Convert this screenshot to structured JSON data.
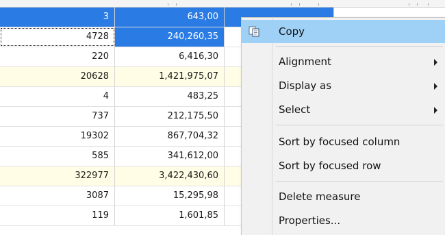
{
  "table": {
    "rows": [
      {
        "c1": "3",
        "c2": "643,00",
        "selected": true,
        "alt": false
      },
      {
        "c1": "4728",
        "c2": "240,260,35",
        "selected": false,
        "alt": false
      },
      {
        "c1": "220",
        "c2": "6,416,30",
        "selected": false,
        "alt": false
      },
      {
        "c1": "20628",
        "c2": "1,421,975,07",
        "selected": false,
        "alt": true
      },
      {
        "c1": "4",
        "c2": "483,25",
        "selected": false,
        "alt": false
      },
      {
        "c1": "737",
        "c2": "212,175,50",
        "selected": false,
        "alt": false
      },
      {
        "c1": "19302",
        "c2": "867,704,32",
        "selected": false,
        "alt": false
      },
      {
        "c1": "585",
        "c2": "341,612,00",
        "selected": false,
        "alt": false
      },
      {
        "c1": "322977",
        "c2": "3,422,430,60",
        "selected": false,
        "alt": true
      },
      {
        "c1": "3087",
        "c2": "15,295,98",
        "selected": false,
        "alt": false
      },
      {
        "c1": "119",
        "c2": "1,601,85",
        "selected": false,
        "alt": false
      }
    ]
  },
  "context_menu": {
    "items": [
      {
        "label": "Copy",
        "icon": "copy-icon",
        "highlighted": true
      },
      {
        "label": "Alignment",
        "submenu": true
      },
      {
        "label": "Display as",
        "submenu": true
      },
      {
        "label": "Select",
        "submenu": true
      },
      {
        "label": "Sort by focused column"
      },
      {
        "label": "Sort by focused row"
      },
      {
        "label": "Delete measure"
      },
      {
        "label": "Properties..."
      }
    ]
  },
  "colors": {
    "selection": "#2a7be4",
    "menu_highlight": "#9fd0f5",
    "alt_row": "#fffde5",
    "menu_background": "#f1f1f1"
  }
}
